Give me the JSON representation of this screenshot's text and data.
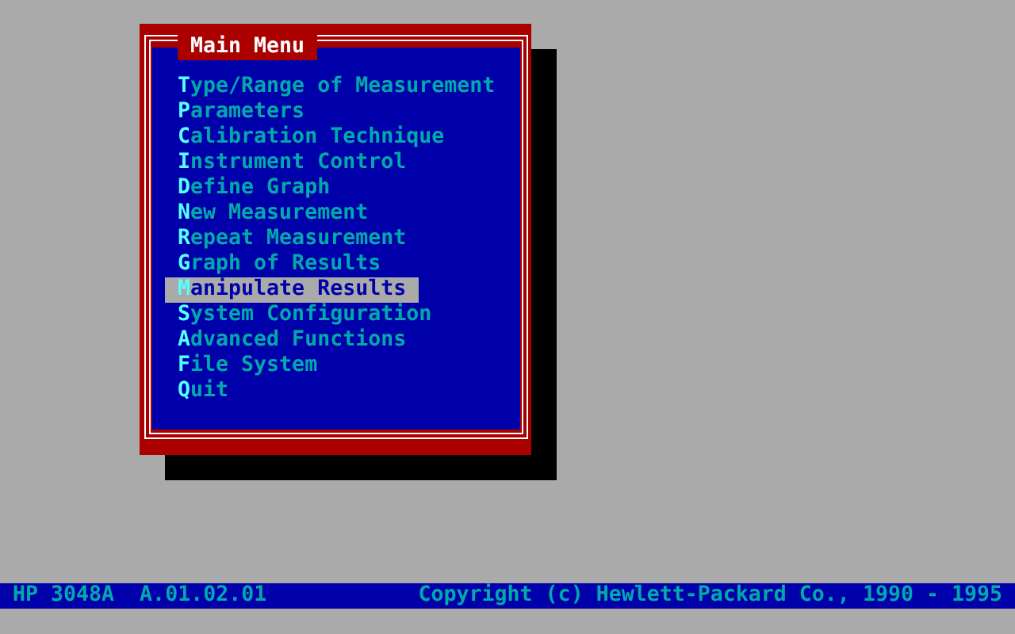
{
  "window": {
    "title": "Main Menu"
  },
  "menu": {
    "items": [
      {
        "label": "Type/Range of Measurement",
        "selected": false
      },
      {
        "label": "Parameters",
        "selected": false
      },
      {
        "label": "Calibration Technique",
        "selected": false
      },
      {
        "label": "Instrument Control",
        "selected": false
      },
      {
        "label": "Define Graph",
        "selected": false
      },
      {
        "label": "New Measurement",
        "selected": false
      },
      {
        "label": "Repeat Measurement",
        "selected": false
      },
      {
        "label": "Graph of Results",
        "selected": false
      },
      {
        "label": "Manipulate Results",
        "selected": true
      },
      {
        "label": "System Configuration",
        "selected": false
      },
      {
        "label": "Advanced Functions",
        "selected": false
      },
      {
        "label": "File System",
        "selected": false
      },
      {
        "label": "Quit",
        "selected": false
      }
    ]
  },
  "status_bar": {
    "product": "HP 3048A  A.01.02.01",
    "copyright": "Copyright (c) Hewlett-Packard Co., 1990 - 1995"
  }
}
